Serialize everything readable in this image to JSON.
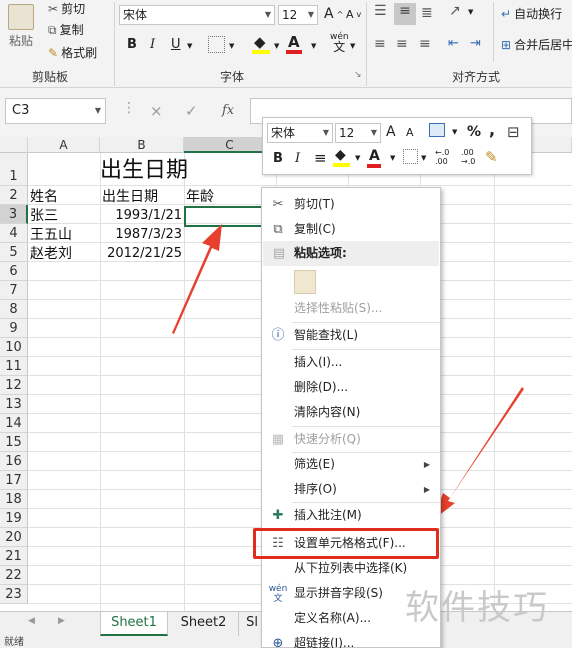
{
  "ribbon": {
    "clipboard": {
      "paste": "粘贴",
      "cut": "剪切",
      "copy": "复制",
      "format_painter": "格式刷",
      "group": "剪贴板"
    },
    "font": {
      "font_name": "宋体",
      "font_size": "12",
      "grow": "A",
      "shrink": "A",
      "bold": "B",
      "italic": "I",
      "underline": "U",
      "wen": "wén",
      "wen_char": "文",
      "group": "字体"
    },
    "alignment": {
      "wrap": "自动换行",
      "merge": "合并后居中",
      "group": "对齐方式"
    }
  },
  "formula_bar": {
    "name_box": "C3",
    "cancel": "×",
    "confirm": "✓",
    "fx": "fx",
    "value": ""
  },
  "sheet": {
    "columns": [
      "A",
      "B",
      "C"
    ],
    "rows": [
      "1",
      "2",
      "3",
      "4",
      "5",
      "6",
      "7",
      "8",
      "9",
      "10",
      "11",
      "12",
      "13",
      "14",
      "15",
      "16",
      "17",
      "18",
      "19",
      "20",
      "21",
      "22",
      "23"
    ],
    "title": "出生日期",
    "header": {
      "a": "姓名",
      "b": "出生日期",
      "c": "年龄"
    },
    "data": [
      {
        "name": "张三",
        "date": "1993/1/21"
      },
      {
        "name": "王五山",
        "date": "1987/3/23"
      },
      {
        "name": "赵老刘",
        "date": "2012/21/25"
      }
    ]
  },
  "tabs": [
    "Sheet1",
    "Sheet2",
    "Sl"
  ],
  "status": "就绪",
  "mini_toolbar": {
    "font_name": "宋体",
    "font_size": "12",
    "grow": "A",
    "shrink": "A",
    "percent": "%",
    "comma": ",",
    "bold": "B",
    "italic": "I",
    "align": "≡",
    "dec_inc": "←.0\n.00",
    "dec_dec": ".00\n→.0"
  },
  "context_menu": {
    "cut": "剪切(T)",
    "copy": "复制(C)",
    "paste_options": "粘贴选项:",
    "paste_special": "选择性粘贴(S)...",
    "smart_lookup": "智能查找(L)",
    "insert": "插入(I)...",
    "delete": "删除(D)...",
    "clear": "清除内容(N)",
    "quick_analysis": "快速分析(Q)",
    "filter": "筛选(E)",
    "sort": "排序(O)",
    "insert_comment": "插入批注(M)",
    "format_cells": "设置单元格格式(F)...",
    "pick_list": "从下拉列表中选择(K)",
    "phonetic": "显示拼音字段(S)",
    "define_name": "定义名称(A)...",
    "hyperlink": "超链接(I)..."
  },
  "watermark": "软件技巧",
  "colors": {
    "accent": "#217346",
    "highlight": "#e02d1f",
    "arrow": "#e8402e"
  }
}
